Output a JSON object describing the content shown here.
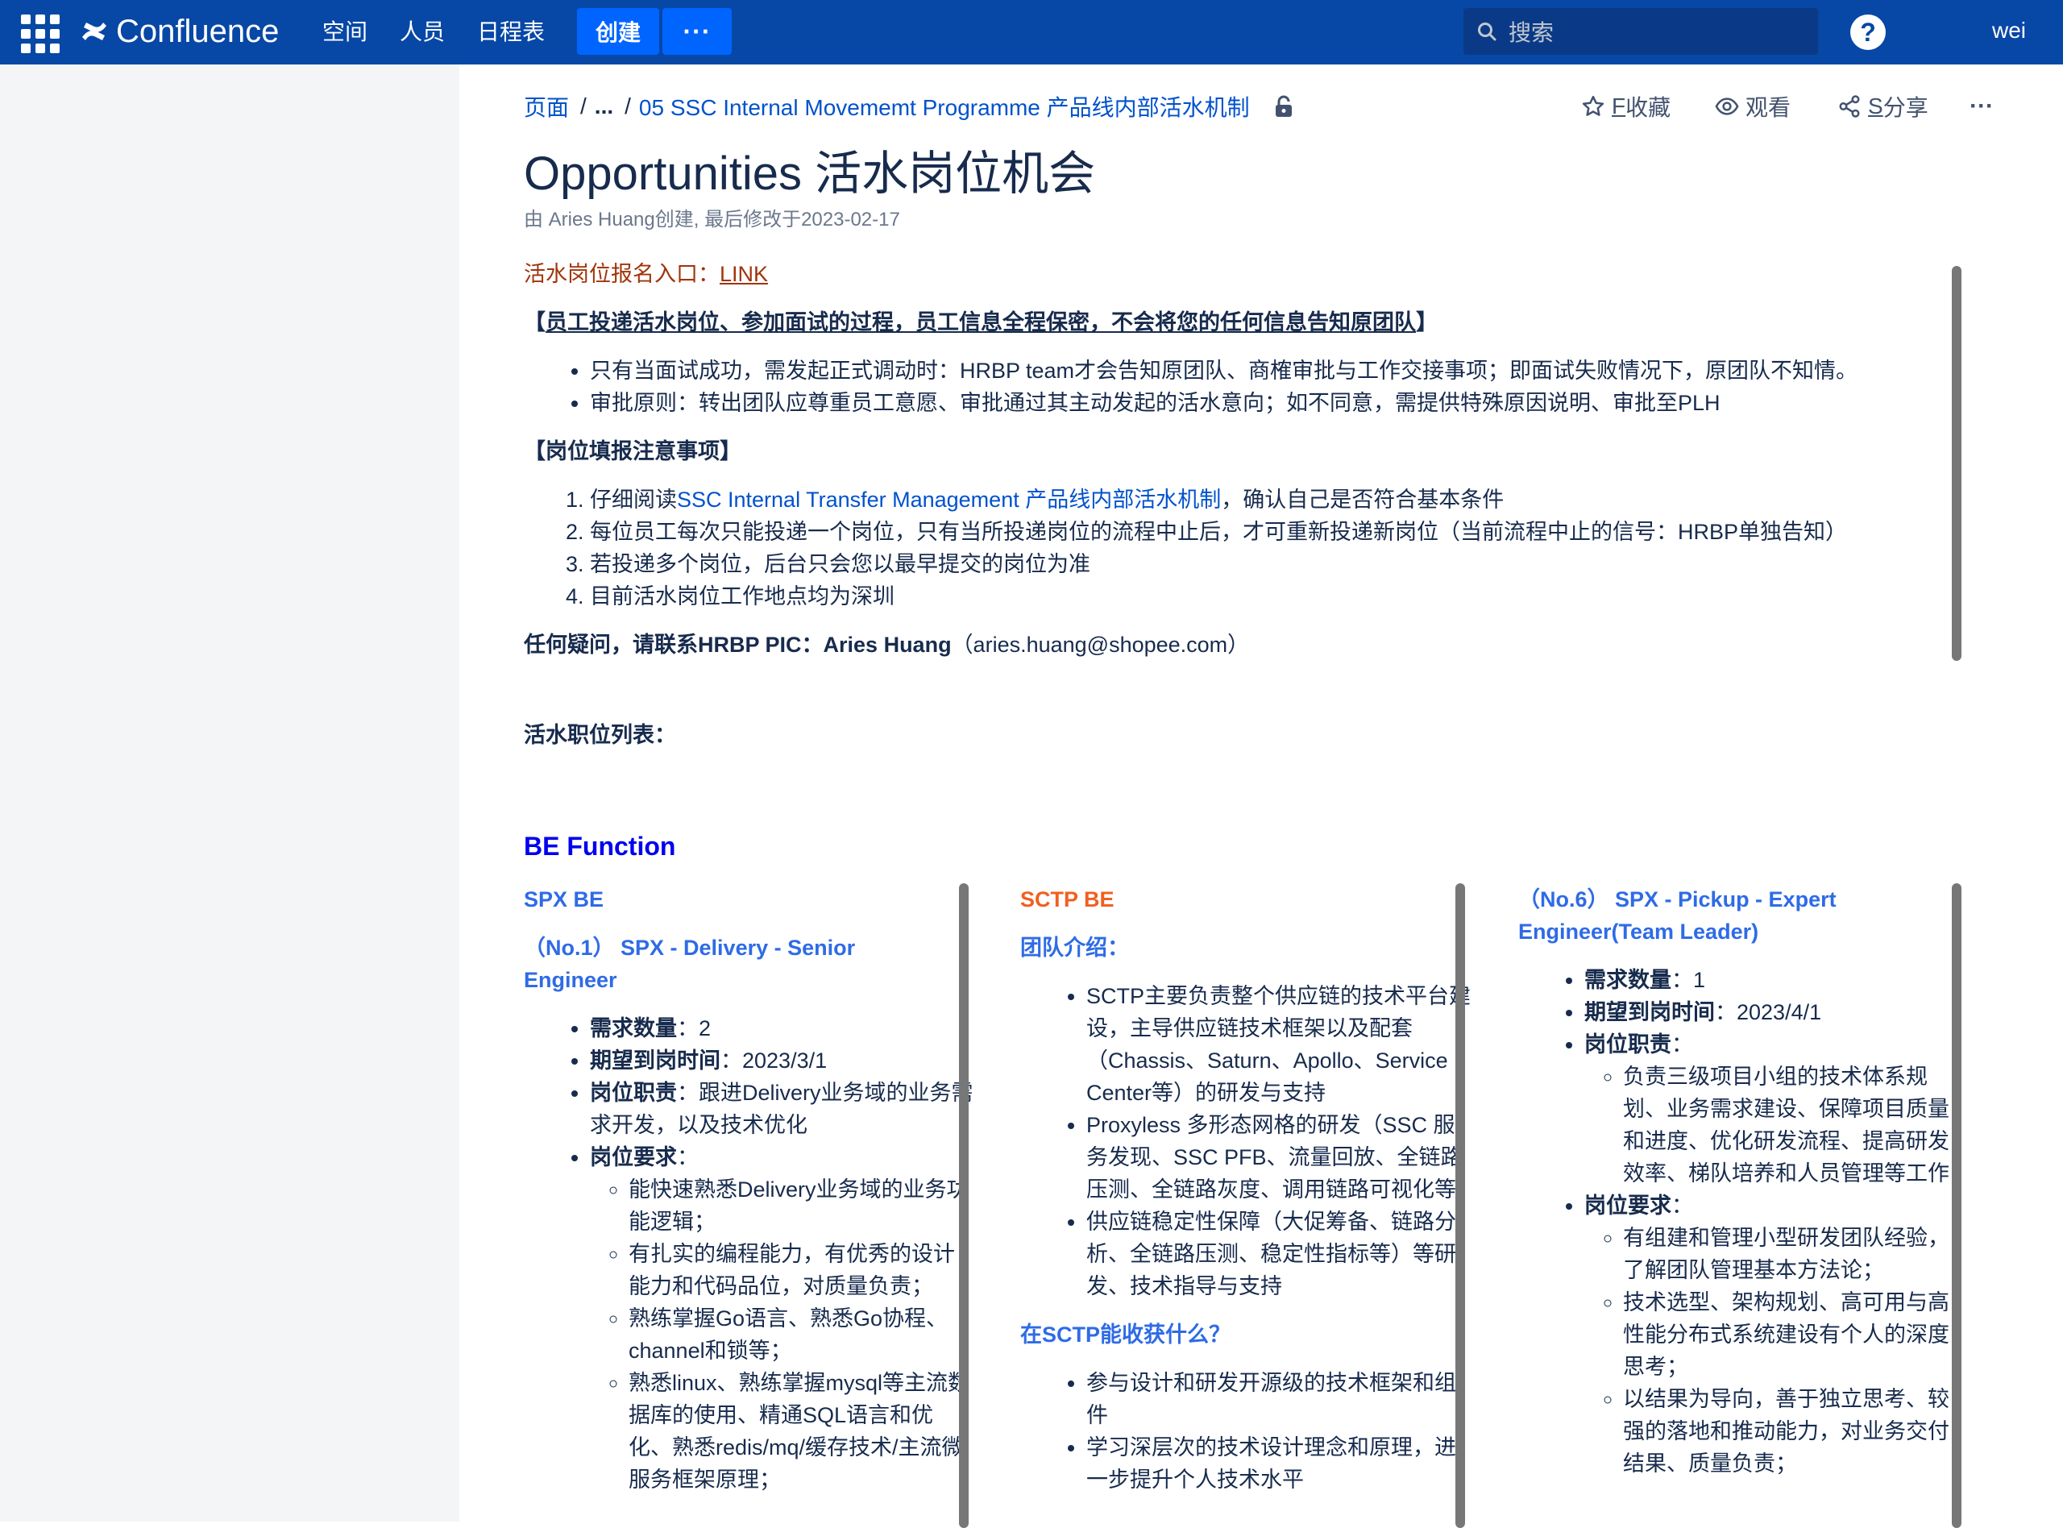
{
  "topnav": {
    "app": "Confluence",
    "items": [
      "空间",
      "人员",
      "日程表"
    ],
    "create_label": "创建",
    "more_label": "···",
    "search_placeholder": "搜索",
    "help_label": "?",
    "user": "wei"
  },
  "breadcrumbs": {
    "root": "页面",
    "sep1": "/",
    "ellipsis": "...",
    "sep2": "/",
    "parent": "05 SSC Internal Movememt Programme 产品线内部活水机制"
  },
  "actions": {
    "star_prefix": "F",
    "star_label": "收藏",
    "watch_label": "观看",
    "share_prefix": "S",
    "share_label": "分享",
    "more_label": "···"
  },
  "page": {
    "title": "Opportunities 活水岗位机会",
    "byline": "由 Aries Huang创建, 最后修改于2023-02-17"
  },
  "content": {
    "signup_label": "活水岗位报名入口：",
    "signup_link": "LINK",
    "privacy_open": "【",
    "privacy_text": "员工投递活水岗位、参加面试的过程，员工信息全程保密，不会将您的任何信息告知原团队",
    "privacy_close": "】",
    "privacy_bullets": [
      "只有当面试成功，需发起正式调动时：HRBP team才会告知原团队、商榷审批与工作交接事项；即面试失败情况下，原团队不知情。",
      "审批原则：转出团队应尊重员工意愿、审批通过其主动发起的活水意向；如不同意，需提供特殊原因说明、审批至PLH"
    ],
    "notes_heading": "【岗位填报注意事项】",
    "notes_1_pre": "仔细阅读",
    "notes_1_link": "SSC Internal Transfer Management 产品线内部活水机制",
    "notes_1_post": "，确认自己是否符合基本条件",
    "notes": [
      "每位员工每次只能投递一个岗位，只有当所投递岗位的流程中止后，才可重新投递新岗位（当前流程中止的信号：HRBP单独告知）",
      "若投递多个岗位，后台只会您以最早提交的岗位为准",
      "目前活水岗位工作地点均为深圳"
    ],
    "contact_bold": "任何疑问，请联系HRBP PIC：Aries Huang",
    "contact_rest": "（aries.huang@shopee.com）",
    "job_list": "活水职位列表：",
    "be_function": "BE Function"
  },
  "col1": {
    "heading": "SPX BE",
    "job_title_line1": "（No.1） SPX - Delivery - Senior",
    "job_title_line2": "Engineer",
    "headcount_label": "需求数量",
    "headcount_value": "：2",
    "date_label": "期望到岗时间",
    "date_value": "：2023/3/1",
    "duty_label": "岗位职责",
    "duty_value": "：跟进Delivery业务域的业务需求开发，以及技术优化",
    "req_label": "岗位要求",
    "req_colon": "：",
    "requirements": [
      "能快速熟悉Delivery业务域的业务功能逻辑；",
      "有扎实的编程能力，有优秀的设计能力和代码品位，对质量负责；",
      "熟练掌握Go语言、熟悉Go协程、channel和锁等；",
      "熟悉linux、熟练掌握mysql等主流数据库的使用、精通SQL语言和优化、熟悉redis/mq/缓存技术/主流微服务框架原理；"
    ]
  },
  "col2": {
    "heading": "SCTP BE",
    "team_intro": "团队介绍：",
    "team_bullets": [
      "SCTP主要负责整个供应链的技术平台建设，主导供应链技术框架以及配套（Chassis、Saturn、Apollo、Service Center等）的研发与支持",
      "Proxyless 多形态网格的研发（SSC 服务发现、SSC PFB、流量回放、全链路压测、全链路灰度、调用链路可视化等）",
      "供应链稳定性保障（大促筹备、链路分析、全链路压测、稳定性指标等）等研发、技术指导与支持"
    ],
    "gain_heading": "在SCTP能收获什么？",
    "gain_bullets": [
      "参与设计和研发开源级的技术框架和组件",
      "学习深层次的技术设计理念和原理，进一步提升个人技术水平"
    ]
  },
  "col3": {
    "job_title": "（No.6） SPX - Pickup - Expert Engineer(Team Leader)",
    "headcount_label": "需求数量",
    "headcount_value": "：1",
    "date_label": "期望到岗时间",
    "date_value": "：2023/4/1",
    "duty_label": "岗位职责",
    "duty_colon": "：",
    "duties": [
      "负责三级项目小组的技术体系规划、业务需求建设、保障项目质量和进度、优化研发流程、提高研发效率、梯队培养和人员管理等工作"
    ],
    "req_label": "岗位要求",
    "req_colon": "：",
    "requirements": [
      "有组建和管理小型研发团队经验，了解团队管理基本方法论；",
      "技术选型、架构规划、高可用与高性能分布式系统建设有个人的深度思考；",
      "以结果为导向，善于独立思考、较强的落地和推动能力，对业务交付结果、质量负责；"
    ]
  }
}
